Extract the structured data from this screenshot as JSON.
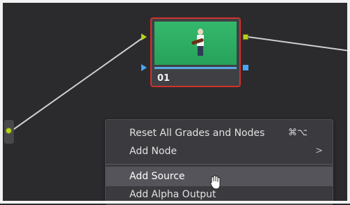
{
  "node": {
    "label": "01"
  },
  "menu": {
    "items": [
      {
        "label": "Reset All Grades and Nodes",
        "shortcut": "⌘⌥"
      },
      {
        "label": "Add Node",
        "arrow": ">"
      },
      {
        "label": "Add Source"
      },
      {
        "label": "Add Alpha Output"
      }
    ]
  },
  "colors": {
    "background": "#2b2b2e",
    "node_border": "#d1322c",
    "port_green": "#b9d31d",
    "port_blue": "#4aa6f2",
    "clip_green": "#34b86c"
  }
}
